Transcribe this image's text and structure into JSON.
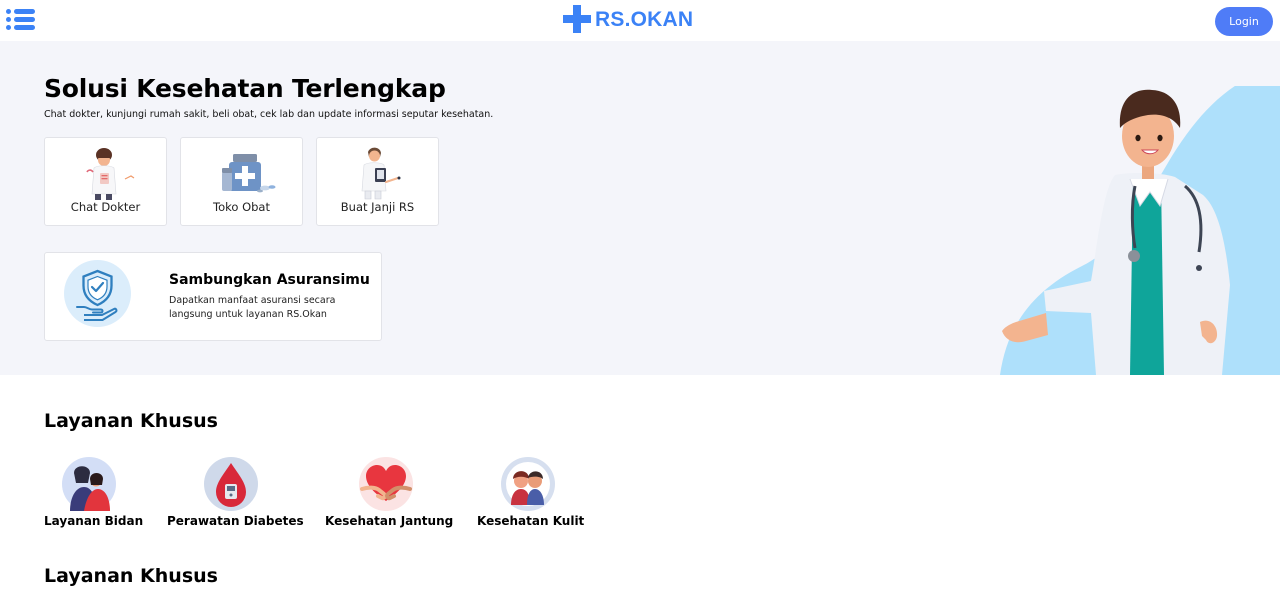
{
  "header": {
    "brand": "RS.OKAN",
    "login_label": "Login",
    "menu_icon": "menu-list-icon",
    "brand_icon": "medical-cross-icon"
  },
  "hero": {
    "title": "Solusi Kesehatan Terlengkap",
    "subtitle": "Chat dokter, kunjungi rumah sakit, beli obat, cek lab dan update informasi seputar kesehatan.",
    "services": [
      {
        "label": "Chat Dokter",
        "icon": "doctor-chat-illustration"
      },
      {
        "label": "Toko Obat",
        "icon": "medicine-bottles-illustration"
      },
      {
        "label": "Buat Janji RS",
        "icon": "doctor-appointment-illustration"
      }
    ],
    "insurance": {
      "title": "Sambungkan Asuransimu",
      "description": "Dapatkan manfaat asuransi secara langsung untuk layanan RS.Okan",
      "icon": "insurance-shield-hand-icon"
    }
  },
  "special_services": {
    "title": "Layanan Khusus",
    "items": [
      {
        "label": "Layanan Bidan",
        "icon": "midwife-icon"
      },
      {
        "label": "Perawatan Diabetes",
        "icon": "diabetes-icon"
      },
      {
        "label": "Kesehatan Jantung",
        "icon": "heart-icon"
      },
      {
        "label": "Kesehatan Kulit",
        "icon": "skin-icon"
      }
    ]
  },
  "second_section": {
    "title": "Layanan Khusus"
  },
  "colors": {
    "brand": "#3b82f6",
    "login_button": "#4f7cf7",
    "hero_background": "#f4f5fa",
    "blob": "#aee0fb"
  }
}
